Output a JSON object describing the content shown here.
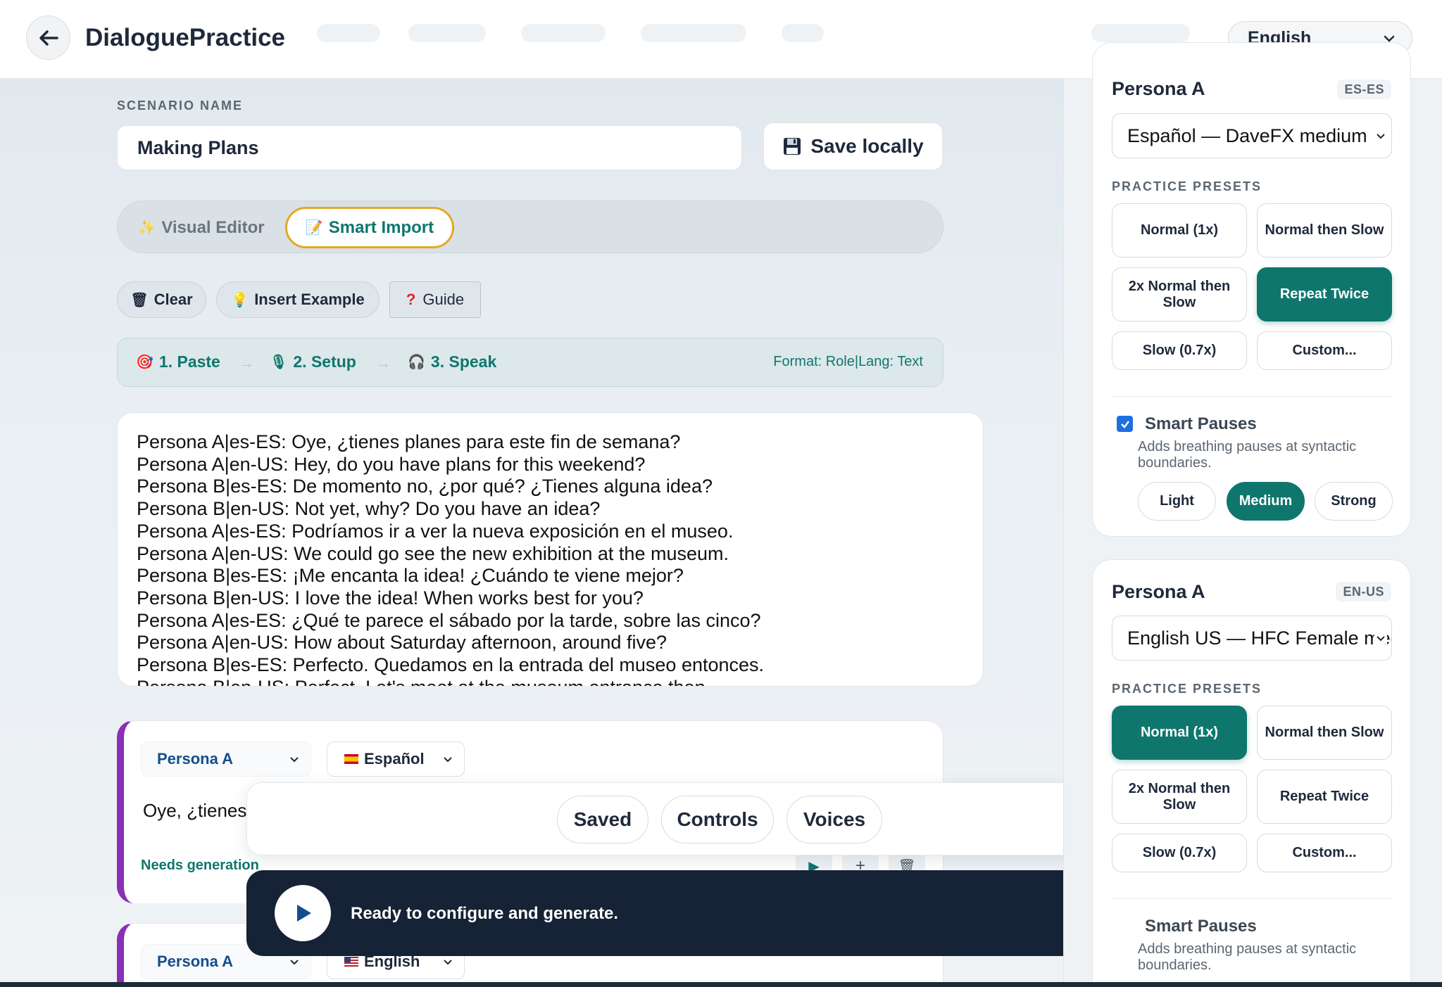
{
  "header": {
    "title": "DialoguePractice",
    "language": "English"
  },
  "scenario": {
    "label": "SCENARIO NAME",
    "name": "Making Plans",
    "save_label": "Save locally",
    "save_icon": "floppy-disk-icon"
  },
  "modes": {
    "visual": "Visual Editor",
    "smart": "Smart Import",
    "active": "smart"
  },
  "toolbar": {
    "clear": "Clear",
    "insert_example": "Insert Example",
    "guide": "Guide"
  },
  "steps": {
    "paste": "1. Paste",
    "setup": "2. Setup",
    "speak": "3. Speak",
    "format": "Format: Role|Lang: Text"
  },
  "import_lines": [
    "Persona A|es-ES: Oye, ¿tienes planes para este fin de semana?",
    "Persona A|en-US: Hey, do you have plans for this weekend?",
    "Persona B|es-ES: De momento no, ¿por qué? ¿Tienes alguna idea?",
    "Persona B|en-US: Not yet, why? Do you have an idea?",
    "Persona A|es-ES: Podríamos ir a ver la nueva exposición en el museo.",
    "Persona A|en-US: We could go see the new exhibition at the museum.",
    "Persona B|es-ES: ¡Me encanta la idea! ¿Cuándo te viene mejor?",
    "Persona B|en-US: I love the idea! When works best for you?",
    "Persona A|es-ES: ¿Qué te parece el sábado por la tarde, sobre las cinco?",
    "Persona A|en-US: How about Saturday afternoon, around five?",
    "Persona B|es-ES: Perfecto. Quedamos en la entrada del museo entonces.",
    "Persona B|en-US: Perfect. Let's meet at the museum entrance then."
  ],
  "cards": [
    {
      "persona": "Persona A",
      "language": "Español",
      "text": "Oye, ¿tienes",
      "status": "Needs generation"
    },
    {
      "persona": "Persona A",
      "language": "English"
    }
  ],
  "float_nav": {
    "saved": "Saved",
    "controls": "Controls",
    "voices": "Voices"
  },
  "status": {
    "message": "Ready to configure and generate."
  },
  "panels": [
    {
      "title": "Persona A",
      "badge": "ES-ES",
      "voice": "Español — DaveFX medium",
      "presets_label": "PRACTICE PRESETS",
      "presets": [
        "Normal (1x)",
        "Normal then Slow",
        "2x Normal then Slow",
        "Repeat Twice",
        "Slow (0.7x)",
        "Custom..."
      ],
      "active_preset": "Repeat Twice",
      "smart_pauses": "Smart Pauses",
      "smart_pauses_checked": true,
      "smart_desc": "Adds breathing pauses at syntactic boundaries.",
      "pause_levels": [
        "Light",
        "Medium",
        "Strong"
      ],
      "active_pause": "Medium"
    },
    {
      "title": "Persona A",
      "badge": "EN-US",
      "voice": "English US — HFC Female medium",
      "presets_label": "PRACTICE PRESETS",
      "presets": [
        "Normal (1x)",
        "Normal then Slow",
        "2x Normal then Slow",
        "Repeat Twice",
        "Slow (0.7x)",
        "Custom..."
      ],
      "active_preset": "Normal (1x)",
      "smart_pauses": "Smart Pauses",
      "smart_desc": "Adds breathing pauses at syntactic boundaries."
    }
  ],
  "colors": {
    "accent": "#0f766e",
    "highlight": "#e5a823",
    "persona_stripe": "#8b2fb6",
    "toast_bg": "#162235"
  }
}
